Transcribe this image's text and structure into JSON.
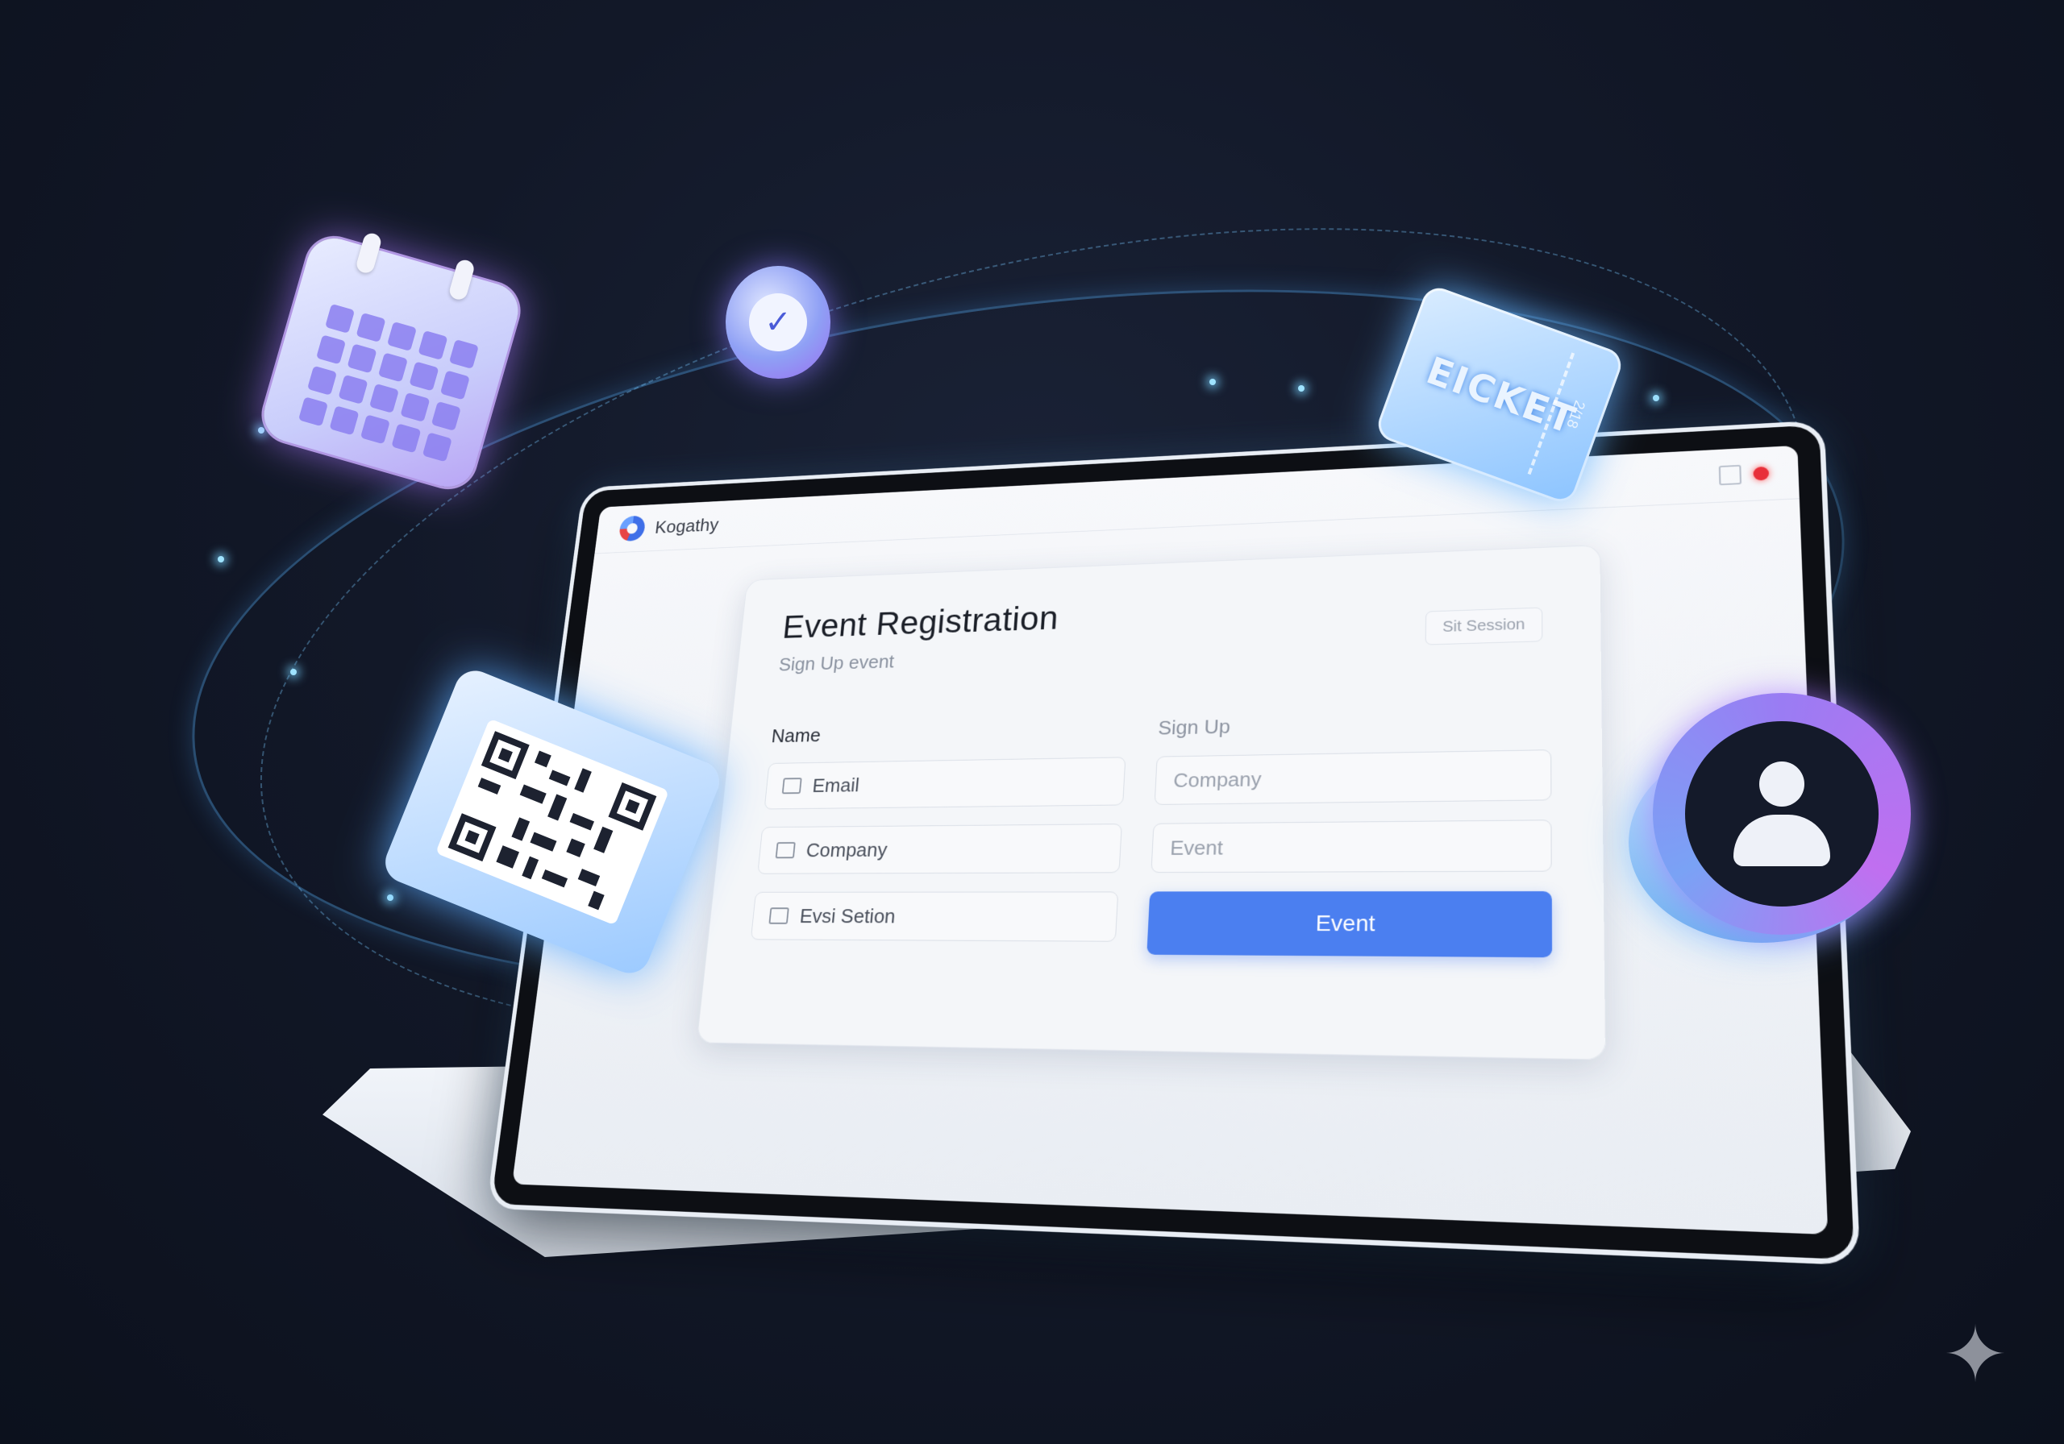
{
  "app": {
    "name": "Kogathy"
  },
  "form": {
    "title": "Event Registration",
    "subtitle": "Sign Up event",
    "header_action": "Sit Session",
    "left_column_label": "Name",
    "right_column_label": "Sign Up",
    "left_fields": [
      {
        "label": "Email",
        "icon": "email-icon"
      },
      {
        "label": "Company",
        "icon": "card-icon"
      },
      {
        "label": "Evsi Setion",
        "icon": "bus-icon"
      }
    ],
    "right_fields": [
      {
        "label": "Company"
      },
      {
        "label": "Event"
      }
    ],
    "submit_label": "Event"
  },
  "widgets": {
    "ticket_text": "EICKET",
    "ticket_stub_text": "2/18"
  },
  "colors": {
    "accent": "#4b7ff0",
    "background": "#121828",
    "glow": "#7cc8ff",
    "record": "#e8303a"
  }
}
